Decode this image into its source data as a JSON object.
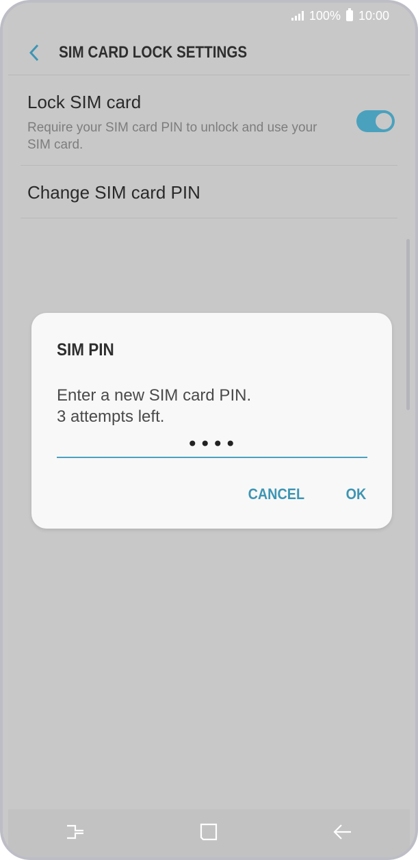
{
  "status_bar": {
    "battery": "100%",
    "time": "10:00"
  },
  "header": {
    "title": "SIM CARD LOCK SETTINGS",
    "back_icon": "chevron-left-icon"
  },
  "settings": {
    "lock_sim": {
      "title": "Lock SIM card",
      "description": "Require your SIM card PIN to unlock and use your SIM card.",
      "enabled": true
    },
    "change_pin": {
      "title": "Change SIM card PIN"
    }
  },
  "dialog": {
    "title": "SIM PIN",
    "message_line1": "Enter a new SIM card PIN.",
    "message_line2": "3 attempts left.",
    "pin_value": "••••",
    "cancel_label": "CANCEL",
    "ok_label": "OK"
  },
  "nav_bar": {
    "recents_icon": "recent-apps-icon",
    "home_icon": "home-icon",
    "back_icon": "back-arrow-icon"
  },
  "colors": {
    "accent": "#4aa1bd",
    "dim_background": "#c8c8c8",
    "dialog_background": "#f8f8f8"
  }
}
